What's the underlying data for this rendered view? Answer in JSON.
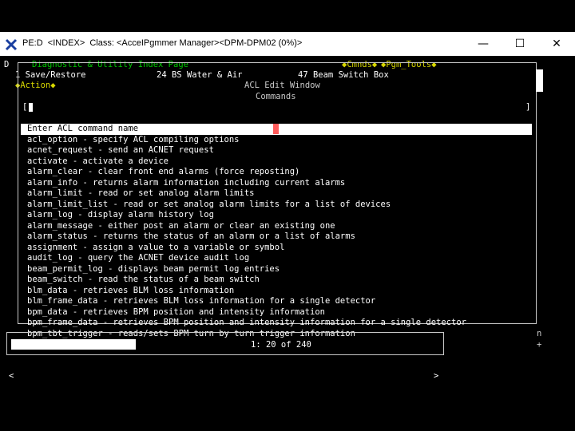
{
  "window": {
    "title": "PE:D  <INDEX>  Class: <AcceIPgmmer Manager><DPM-DPM02 (0%)>",
    "min_glyph": "—",
    "max_glyph": "☐",
    "close_glyph": "✕"
  },
  "terminal": {
    "row0_marker": "D",
    "page_title": "Diagnostic & Utility Index Page",
    "cmnds": "◆Cmnds◆",
    "pgm_tools": "◆Pgm_Tools◆",
    "menu_row": "1 Save/Restore              24 BS Water & Air           47 Beam Switch Box",
    "action": "◆Action◆",
    "acl_edit": "ACL Edit Window",
    "commands_label": "Commands",
    "cmd_left": "[",
    "cmd_right": "]",
    "side_letter_p": "p",
    "side_letter_n": "n",
    "side_plus": "+",
    "position_status": "1: 20 of 240",
    "bottom_left": "<",
    "bottom_right": ">"
  },
  "commands": [
    "Enter ACL command name",
    "acl_option - specify ACL compiling options",
    "acnet_request - send an ACNET request",
    "activate - activate a device",
    "alarm_clear - clear front end alarms (force reposting)",
    "alarm_info - returns alarm information including current alarms",
    "alarm_limit - read or set analog alarm limits",
    "alarm_limit_list - read or set analog alarm limits for a list of devices",
    "alarm_log - display alarm history log",
    "alarm_message - either post an alarm or clear an existing one",
    "alarm_status - returns the status of an alarm or a list of alarms",
    "assignment - assign a value to a variable or symbol",
    "audit_log - query the ACNET device audit log",
    "beam_permit_log - displays beam permit log entries",
    "beam_switch - read the status of a beam switch",
    "blm_data - retrieves BLM loss information",
    "blm_frame_data - retrieves BLM loss information for a single detector",
    "bpm_data - retrieves BPM position and intensity information",
    "bpm_frame_data - retrieves BPM position and intensity information for a single detector",
    "bpm_tbt_trigger - reads/sets BPM turn by turn trigger information"
  ]
}
